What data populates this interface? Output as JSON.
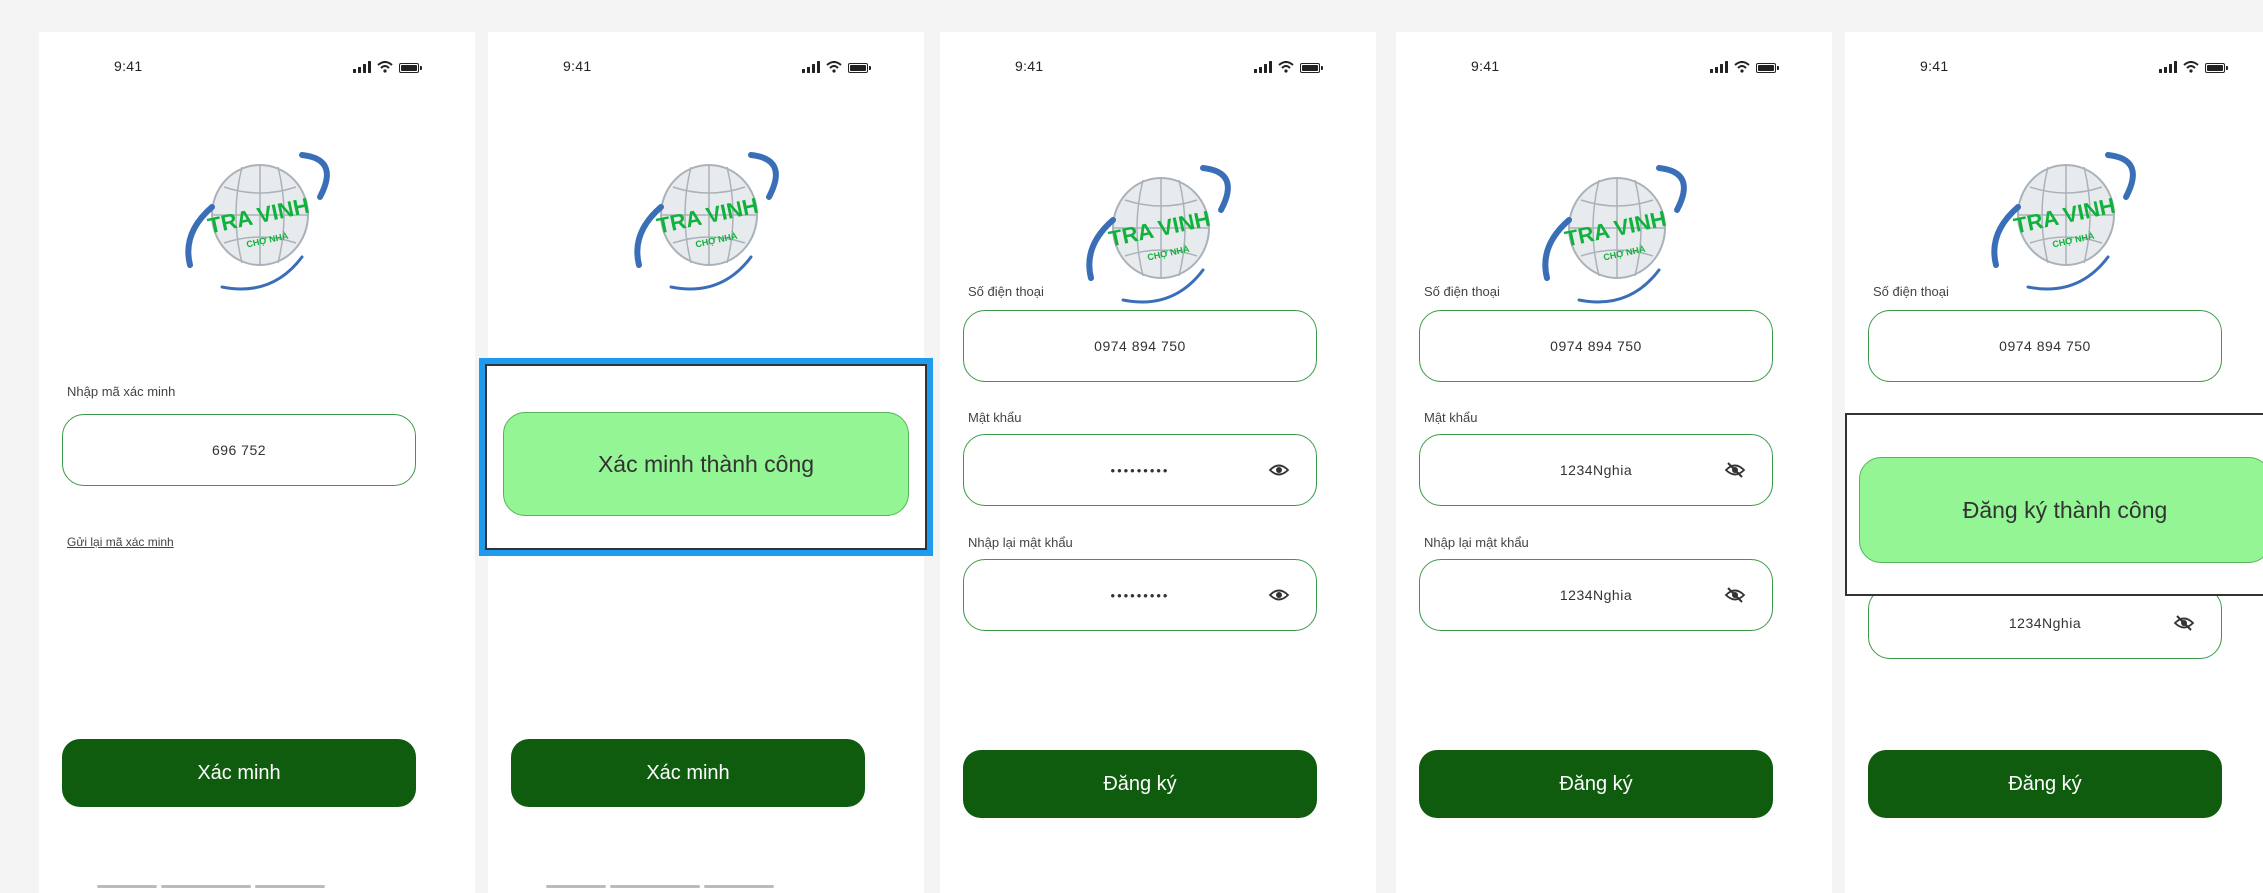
{
  "status": {
    "time": "9:41"
  },
  "icons": {
    "signal": "signal-icon",
    "wifi": "wifi-icon",
    "battery": "battery-icon",
    "eye_open": "eye-icon",
    "eye_off": "eye-off-icon"
  },
  "logo": {
    "line1": "TRA VINH",
    "line2": "CHỢ NHÀ",
    "colors": {
      "green": "#0fb23a",
      "globe": "#bfc6cc",
      "swoosh": "#3a6fb8"
    }
  },
  "screen1": {
    "code_label": "Nhập mã xác minh",
    "code_value": "696 752",
    "resend_link": "Gửi lại mã xác minh",
    "verify_button": "Xác minh"
  },
  "screen2": {
    "popup_message": "Xác minh thành công",
    "verify_button": "Xác minh"
  },
  "screen3": {
    "phone_label": "Số điện thoại",
    "phone_value": "0974 894 750",
    "password_label": "Mật khẩu",
    "password_value": "•••••••••",
    "confirm_label": "Nhập lại mật khẩu",
    "confirm_value": "•••••••••",
    "register_button": "Đăng ký"
  },
  "screen4": {
    "phone_label": "Số điện thoại",
    "phone_value": "0974 894 750",
    "password_label": "Mật khẩu",
    "password_value": "1234Nghia",
    "confirm_label": "Nhập lại mật khẩu",
    "confirm_value": "1234Nghia",
    "register_button": "Đăng ký"
  },
  "screen5": {
    "phone_label": "Số điện thoại",
    "phone_value": "0974 894 750",
    "confirm_value": "1234Nghia",
    "popup_message": "Đăng ký thành công",
    "register_button": "Đăng ký"
  },
  "colors": {
    "primary": "#0f5c0f",
    "field_border": "#3b9a4a",
    "success": "#93f593",
    "selection": "#1e9bf0"
  }
}
